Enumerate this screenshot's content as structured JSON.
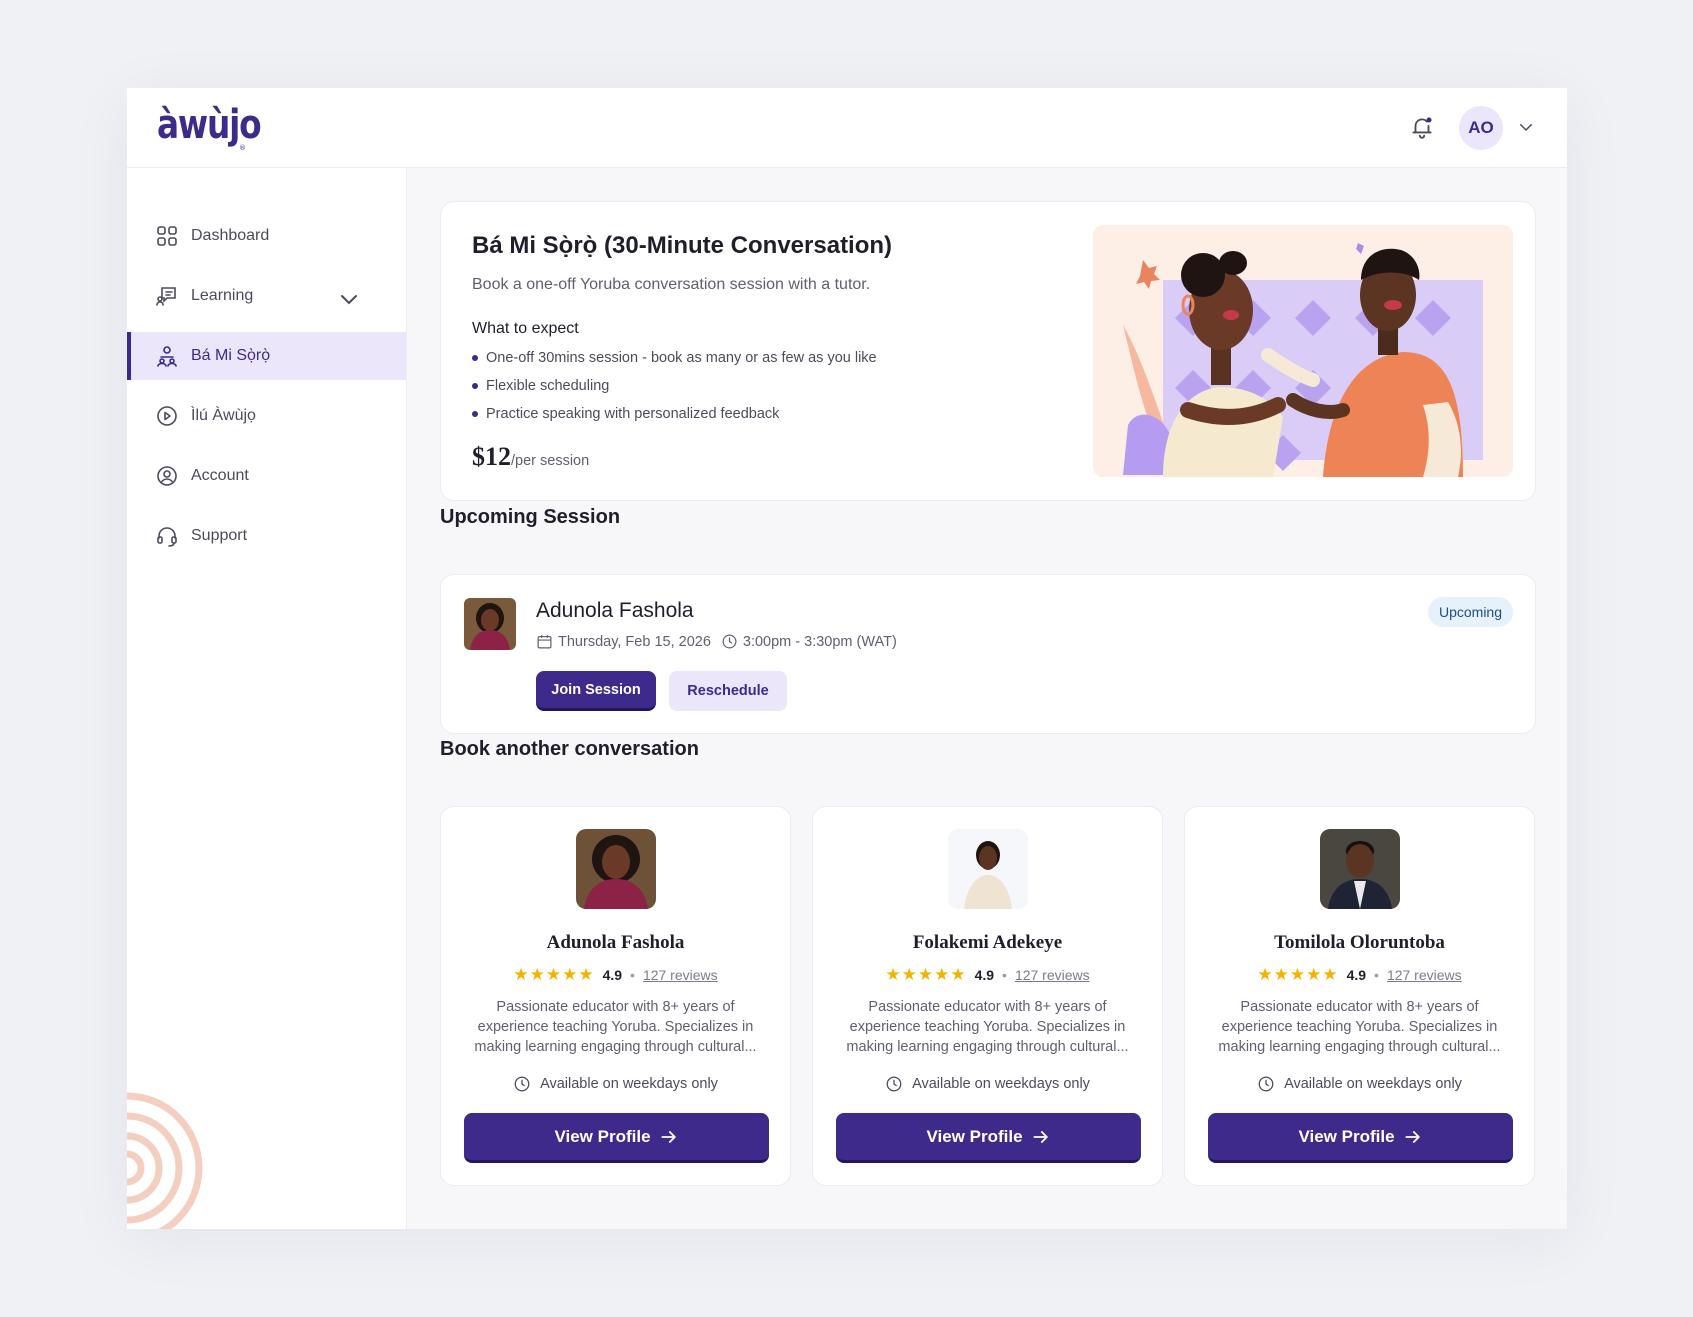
{
  "brand": {
    "logo_text": "àwùjo",
    "logo_mark": "®"
  },
  "header": {
    "user_initials": "AO",
    "notification_icon": "bell-icon"
  },
  "sidebar": {
    "items": [
      {
        "label": "Dashboard",
        "icon": "grid-icon"
      },
      {
        "label": "Learning",
        "icon": "chat-board-icon"
      },
      {
        "label": "Bá Mi Sọ̀rọ̀",
        "icon": "people-icon",
        "active": true
      },
      {
        "label": "Ìlú Àwùjọ",
        "icon": "play-circle-icon"
      },
      {
        "label": "Account",
        "icon": "user-circle-icon"
      },
      {
        "label": "Support",
        "icon": "headset-icon"
      }
    ]
  },
  "hero": {
    "title": "Bá Mi Sọ̀rọ̀ (30-Minute Conversation)",
    "subtitle": "Book a one-off Yoruba conversation session with a tutor.",
    "expect_heading": "What to expect",
    "bullets": [
      "One-off 30mins session - book as many or as few as you like",
      "Flexible scheduling",
      "Practice speaking with personalized feedback"
    ],
    "price": "$12",
    "price_unit": "/per session"
  },
  "upcoming": {
    "section_title": "Upcoming Session",
    "tutor_name": "Adunola Fashola",
    "date": "Thursday, Feb 15, 2026",
    "time": "3:00pm - 3:30pm (WAT)",
    "status": "Upcoming",
    "join_label": "Join Session",
    "reschedule_label": "Reschedule"
  },
  "book": {
    "section_title": "Book another conversation",
    "tutors": [
      {
        "name": "Adunola Fashola",
        "rating": "4.9",
        "reviews": "127 reviews",
        "bio": "Passionate educator with 8+ years of experience teaching Yoruba. Specializes in making learning engaging through cultural...",
        "availability": "Available on weekdays only",
        "button": "View Profile"
      },
      {
        "name": "Folakemi Adekeye",
        "rating": "4.9",
        "reviews": "127 reviews",
        "bio": "Passionate educator with 8+ years of experience teaching Yoruba. Specializes in making learning engaging through cultural...",
        "availability": "Available on weekdays only",
        "button": "View Profile"
      },
      {
        "name": "Tomilola Oloruntoba",
        "rating": "4.9",
        "reviews": "127 reviews",
        "bio": "Passionate educator with 8+ years of experience teaching Yoruba. Specializes in making learning engaging through cultural...",
        "availability": "Available on weekdays only",
        "button": "View Profile"
      }
    ]
  },
  "colors": {
    "brand": "#3d2a8a",
    "active_bg": "#ece6fb",
    "star": "#f5b301",
    "badge_bg": "#e6f1fb"
  }
}
